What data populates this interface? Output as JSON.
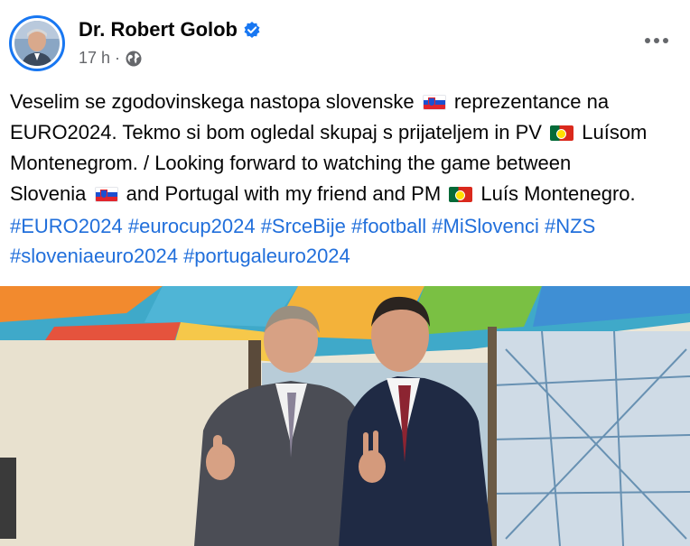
{
  "post": {
    "author": "Dr. Robert Golob",
    "time": "17 h",
    "separator": "·",
    "icons": {
      "verified": "verified-badge-icon",
      "audience": "globe-icon",
      "more": "more-options-icon"
    }
  },
  "text": {
    "l1a": "Veselim se zgodovinskega nastopa slovenske",
    "l1b": "reprezentance na",
    "l2a": "EURO2024. Tekmo si bom ogledal skupaj s prijateljem in PV",
    "l2b": "Luísom",
    "l3": "Montenegrom. / Looking forward to watching the game between",
    "l4a": "Slovenia",
    "l4b": "and Portugal with my friend and PM",
    "l4c": "Luís Montenegro."
  },
  "hashtags": [
    "#EURO2024",
    "#eurocup2024",
    "#SrceBije",
    "#football",
    "#MiSlovenci",
    "#NZS",
    "#sloveniaeuro2024",
    "#portugaleuro2024"
  ],
  "colors": {
    "accent": "#1877f2",
    "hashtag": "#216fdb",
    "meta": "#65676b"
  }
}
